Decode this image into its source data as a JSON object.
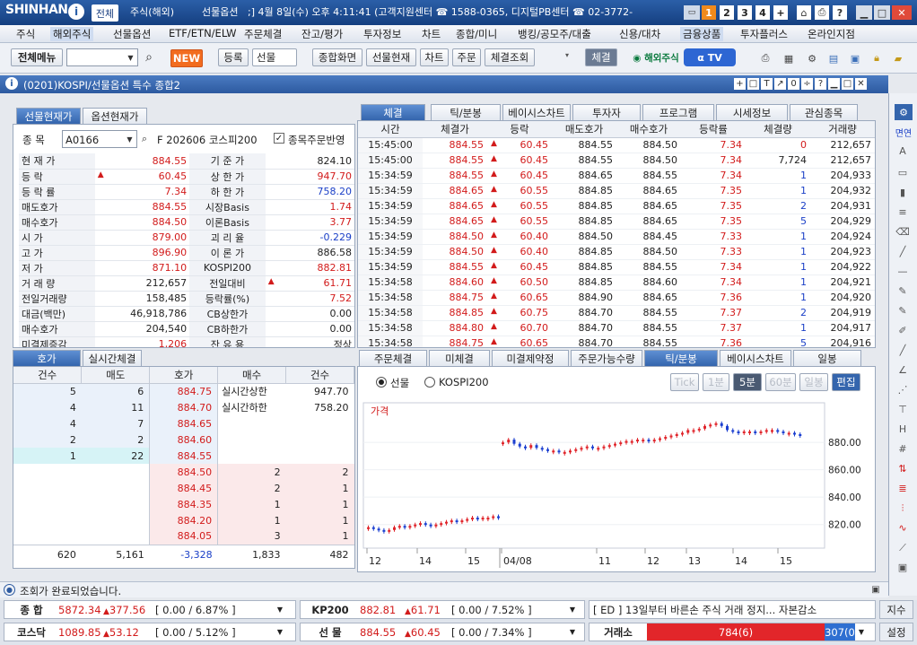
{
  "app": {
    "logo": "SHINHAN",
    "title_tabs": [
      "전체",
      "주식(해외)",
      "선물옵션"
    ],
    "info": ";] 4월 8일(수) 오후 4:11:41 (고객지원센터 ☎ 1588-0365, 디지털PB센터 ☎ 02-3772-",
    "num_buttons": [
      "1",
      "2",
      "3",
      "4",
      "+"
    ]
  },
  "menu": [
    "주식",
    "해외주식",
    "선물옵션",
    "ETF/ETN/ELW",
    "주문체결",
    "잔고/평가",
    "투자정보",
    "차트",
    "종합/미니",
    "뱅킹/공모주/대출",
    "신용/대차",
    "금융상품",
    "투자플러스",
    "온라인지점"
  ],
  "toolbar": {
    "all_menu": "전체메뉴",
    "new_badge": "NEW",
    "register": "등록",
    "futures_select": "선물",
    "buttons": [
      "종합화면",
      "선물현재",
      "차트",
      "주문",
      "체결조회"
    ],
    "execution": "체결",
    "overseas": "해외주식",
    "tv": "TV"
  },
  "window": {
    "title": "(0201)KOSPI/선물옵션 특수 종합2",
    "ctrl": [
      "+",
      "□",
      "T",
      "↗",
      "0",
      "÷",
      "?"
    ]
  },
  "left": {
    "tabs": [
      "선물현재가",
      "옵션현재가"
    ],
    "code_label": "종 목",
    "code": "A0166",
    "code_name": "F 202606 코스피200",
    "reflect_label": "종목주문반영",
    "rows": [
      {
        "l": "현 재 가",
        "v": "884.55",
        "vc": "red",
        "l2": "기 준 가",
        "v2": "824.10",
        "v2c": ""
      },
      {
        "l": "등    락",
        "v": "60.45",
        "vc": "red",
        "tri": true,
        "l2": "상 한 가",
        "v2": "947.70",
        "v2c": "red"
      },
      {
        "l": "등 락 률",
        "v": "7.34",
        "vc": "red",
        "l2": "하 한 가",
        "v2": "758.20",
        "v2c": "blue"
      },
      {
        "l": "매도호가",
        "v": "884.55",
        "vc": "red",
        "l2": "시장Basis",
        "v2": "1.74",
        "v2c": "red"
      },
      {
        "l": "매수호가",
        "v": "884.50",
        "vc": "red",
        "l2": "이론Basis",
        "v2": "3.77",
        "v2c": "red"
      },
      {
        "l": "시    가",
        "v": "879.00",
        "vc": "red",
        "l2": "괴 리 율",
        "v2": "-0.229",
        "v2c": "blue"
      },
      {
        "l": "고    가",
        "v": "896.90",
        "vc": "red",
        "l2": "이 론 가",
        "v2": "886.58",
        "v2c": ""
      },
      {
        "l": "저    가",
        "v": "871.10",
        "vc": "red",
        "l2": "KOSPI200",
        "v2": "882.81",
        "v2c": "red"
      },
      {
        "l": "거 래 량",
        "v": "212,657",
        "vc": "",
        "l2": "전일대비",
        "v2": "61.71",
        "v2c": "red",
        "tri2": true
      },
      {
        "l": "전일거래량",
        "v": "158,485",
        "vc": "",
        "l2": "등락률(%)",
        "v2": "7.52",
        "v2c": "red"
      },
      {
        "l": "대금(백만)",
        "v": "46,918,786",
        "vc": "",
        "l2": "CB상한가",
        "v2": "0.00",
        "v2c": ""
      },
      {
        "l": "매수호가",
        "v": "204,540",
        "vc": "",
        "l2": "CB하한가",
        "v2": "0.00",
        "v2c": "",
        "lfix": "미결제약정"
      },
      {
        "l": "미결제증감",
        "v": "1,206",
        "vc": "red",
        "l2": "잔 유 용",
        "v2": "정상",
        "v2c": ""
      }
    ]
  },
  "orderbook": {
    "tabs": [
      "호가",
      "실시간체결"
    ],
    "headers": [
      "건수",
      "매도",
      "호가",
      "매수",
      "건수"
    ],
    "ask": [
      {
        "cnt": "5",
        "qty": "6",
        "price": "884.75"
      },
      {
        "cnt": "4",
        "qty": "11",
        "price": "884.70"
      },
      {
        "cnt": "4",
        "qty": "7",
        "price": "884.65"
      },
      {
        "cnt": "2",
        "qty": "2",
        "price": "884.60"
      },
      {
        "cnt": "1",
        "qty": "22",
        "price": "884.55"
      }
    ],
    "limits": [
      {
        "l": "실시간상한",
        "v": "947.70"
      },
      {
        "l": "실시간하한",
        "v": "758.20"
      }
    ],
    "bid": [
      {
        "price": "884.50",
        "qty": "2",
        "cnt": "2"
      },
      {
        "price": "884.45",
        "qty": "2",
        "cnt": "1"
      },
      {
        "price": "884.35",
        "qty": "1",
        "cnt": "1"
      },
      {
        "price": "884.20",
        "qty": "1",
        "cnt": "1"
      },
      {
        "price": "884.05",
        "qty": "3",
        "cnt": "1"
      }
    ],
    "totals": [
      "620",
      "5,161",
      "-3,328",
      "1,833",
      "482"
    ]
  },
  "trades": {
    "tabs": [
      "체결",
      "틱/분봉",
      "베이시스차트",
      "투자자",
      "프로그램",
      "시세정보",
      "관심종목"
    ],
    "headers": [
      "시간",
      "체결가",
      "등락",
      "매도호가",
      "매수호가",
      "등락률",
      "체결량",
      "거래량"
    ],
    "rows": [
      [
        "15:45:00",
        "884.55",
        "60.45",
        "884.55",
        "884.50",
        "7.34",
        "0",
        "212,657"
      ],
      [
        "15:45:00",
        "884.55",
        "60.45",
        "884.55",
        "884.50",
        "7.34",
        "7,724",
        "212,657"
      ],
      [
        "15:34:59",
        "884.55",
        "60.45",
        "884.65",
        "884.55",
        "7.34",
        "1",
        "204,933"
      ],
      [
        "15:34:59",
        "884.65",
        "60.55",
        "884.85",
        "884.65",
        "7.35",
        "1",
        "204,932"
      ],
      [
        "15:34:59",
        "884.65",
        "60.55",
        "884.85",
        "884.65",
        "7.35",
        "2",
        "204,931"
      ],
      [
        "15:34:59",
        "884.65",
        "60.55",
        "884.85",
        "884.65",
        "7.35",
        "5",
        "204,929"
      ],
      [
        "15:34:59",
        "884.50",
        "60.40",
        "884.50",
        "884.45",
        "7.33",
        "1",
        "204,924"
      ],
      [
        "15:34:59",
        "884.50",
        "60.40",
        "884.85",
        "884.50",
        "7.33",
        "1",
        "204,923"
      ],
      [
        "15:34:59",
        "884.55",
        "60.45",
        "884.85",
        "884.55",
        "7.34",
        "1",
        "204,922"
      ],
      [
        "15:34:58",
        "884.60",
        "60.50",
        "884.85",
        "884.60",
        "7.34",
        "1",
        "204,921"
      ],
      [
        "15:34:58",
        "884.75",
        "60.65",
        "884.90",
        "884.65",
        "7.36",
        "1",
        "204,920"
      ],
      [
        "15:34:58",
        "884.85",
        "60.75",
        "884.70",
        "884.55",
        "7.37",
        "2",
        "204,919"
      ],
      [
        "15:34:58",
        "884.80",
        "60.70",
        "884.70",
        "884.55",
        "7.37",
        "1",
        "204,917"
      ],
      [
        "15:34:58",
        "884.75",
        "60.65",
        "884.70",
        "884.55",
        "7.36",
        "5",
        "204,916"
      ]
    ]
  },
  "chartpanel": {
    "tabs": [
      "주문체결",
      "미체결",
      "미결제약정",
      "주문가능수량",
      "틱/분봉",
      "베이시스차트",
      "일봉"
    ],
    "radio1": "선물",
    "radio2": "KOSPI200",
    "period_buttons": [
      "Tick",
      "1분",
      "5분",
      "60분",
      "일봉",
      "편집"
    ],
    "price_label": "가격"
  },
  "chart_data": {
    "type": "candlestick",
    "ylim": [
      808,
      905
    ],
    "yticks": [
      "880.00",
      "860.00",
      "840.00",
      "820.00"
    ],
    "ytick_values": [
      880,
      860,
      840,
      820
    ],
    "xticks": [
      "12",
      "14",
      "15",
      "04/08",
      "11",
      "12",
      "13",
      "14",
      "15"
    ],
    "seg1": [
      818,
      817,
      816,
      815,
      816,
      818,
      819,
      818,
      819,
      820,
      821,
      820,
      819,
      820,
      821,
      822,
      823,
      822,
      823,
      824,
      825,
      824,
      825,
      825,
      826,
      825
    ],
    "seg2": [
      880,
      882,
      879,
      877,
      876,
      878,
      876,
      875,
      874,
      874,
      873,
      873,
      874,
      875,
      876,
      877,
      876,
      876,
      877,
      878,
      879,
      880,
      881,
      881,
      882,
      882,
      881,
      882,
      883,
      884,
      885,
      886,
      887,
      889,
      889,
      890,
      892,
      893,
      894,
      892,
      889,
      888,
      887,
      888,
      888,
      887,
      888,
      889,
      889,
      888,
      887,
      887,
      886,
      885
    ]
  },
  "status": {
    "text": "조회가 완료되었습니다."
  },
  "ticker": {
    "r1": [
      {
        "label": "종  합",
        "val": "5872.34",
        "chg": "377.56",
        "rest": "[ 0.00 / 6.87% ]"
      },
      {
        "label": "KP200",
        "val": "882.81",
        "chg": "61.71",
        "rest": "[ 0.00 / 7.52% ]"
      },
      {
        "label": "[ ED ] 13일부터 바른손 주식 거래 정지... 자본감소"
      }
    ],
    "r2": [
      {
        "label": "코스닥",
        "val": "1089.85",
        "chg": "53.12",
        "rest": "[ 0.00 / 5.12% ]"
      },
      {
        "label": "선  물",
        "val": "884.55",
        "chg": "60.45",
        "rest": "[ 0.00 / 7.34% ]"
      },
      {
        "label": "거래소",
        "val": "784(6)",
        "extra": "307(0"
      }
    ],
    "right1": "지수",
    "right2": "설정"
  },
  "colors": {
    "up": "#d21b1b",
    "down": "#1a3fc7",
    "accent": "#3465ad"
  }
}
